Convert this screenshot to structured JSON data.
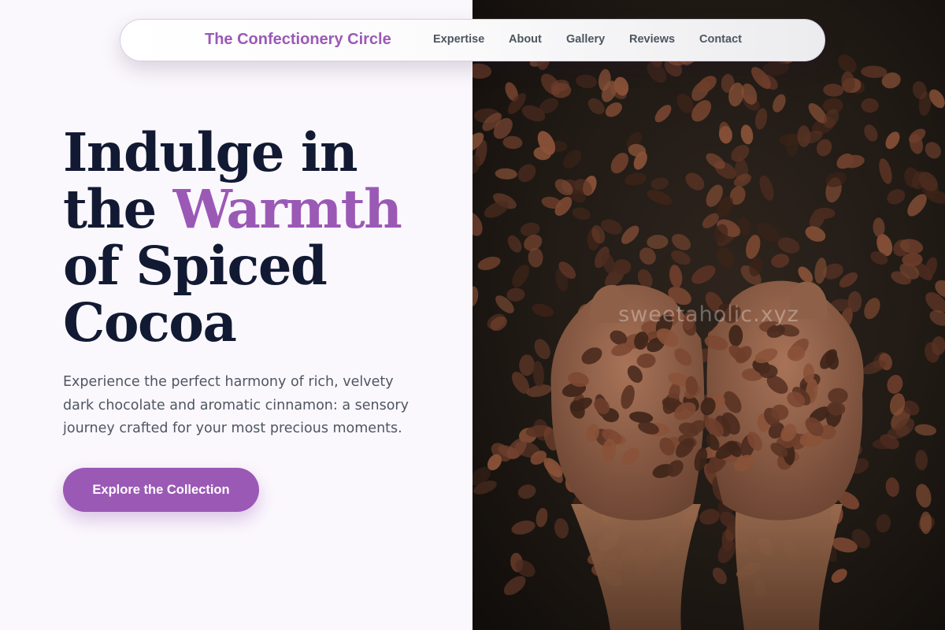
{
  "nav": {
    "brand": "The Confectionery Circle",
    "links": [
      "Expertise",
      "About",
      "Gallery",
      "Reviews",
      "Contact"
    ]
  },
  "hero": {
    "title_lines": [
      {
        "before": "Indulge in",
        "accent": ""
      },
      {
        "before": "the ",
        "accent": "Warmth"
      },
      {
        "before": "of Spiced",
        "accent": ""
      },
      {
        "before": "Cocoa",
        "accent": ""
      }
    ],
    "description": "Experience the perfect harmony of rich, velvety dark chocolate and aromatic cinnamon: a sensory journey crafted for your most precious moments.",
    "cta_label": "Explore the Collection",
    "image_watermark": "sweetaholic.xyz"
  },
  "colors": {
    "accent": "#9b59b6",
    "heading": "#121a33",
    "body_text": "#4e5663",
    "nav_text": "#4d5560",
    "page_bg": "#fbf8fd",
    "image_bg": "#1c1612"
  }
}
